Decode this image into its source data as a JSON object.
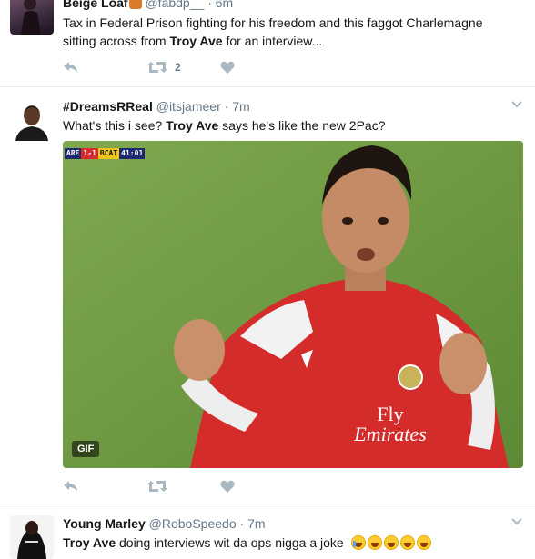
{
  "tweets": [
    {
      "fullname": "Beige Loaf",
      "username": "@fabdp__",
      "time": "6m",
      "text_pre": "Tax in Federal Prison fighting for his freedom and this faggot Charlemagne sitting across from ",
      "text_bold": "Troy Ave",
      "text_post": " for an interview...",
      "retweet_count": "2",
      "reply_icon": "reply-icon",
      "retweet_icon": "retweet-icon",
      "like_icon": "heart-icon"
    },
    {
      "fullname": "#DreamsRReal",
      "username": "@itsjameer",
      "time": "7m",
      "text_pre": "What's this i see? ",
      "text_bold": "Troy Ave",
      "text_post": " says he's like the new 2Pac?",
      "gif_label": "GIF",
      "scorebug": {
        "team1": "ARE",
        "score": "1-1",
        "team2": "BCAT",
        "clock": "41:01"
      },
      "shirt_text_1": "Fly",
      "shirt_text_2": "Emirates"
    },
    {
      "fullname": "Young Marley",
      "username": "@RoboSpeedo",
      "time": "7m",
      "text_bold": "Troy Ave",
      "text_post": " doing interviews wit da ops nigga a joke",
      "emojis": [
        "face-with-tears-of-joy",
        "face-with-tears-of-joy",
        "face-with-tears-of-joy",
        "face-with-tears-of-joy",
        "face-with-tears-of-joy"
      ]
    }
  ],
  "dot": "·",
  "colors": {
    "action_icon": "#aab8c2",
    "name": "#14171a",
    "meta": "#657786",
    "border": "#e6ecf0"
  }
}
